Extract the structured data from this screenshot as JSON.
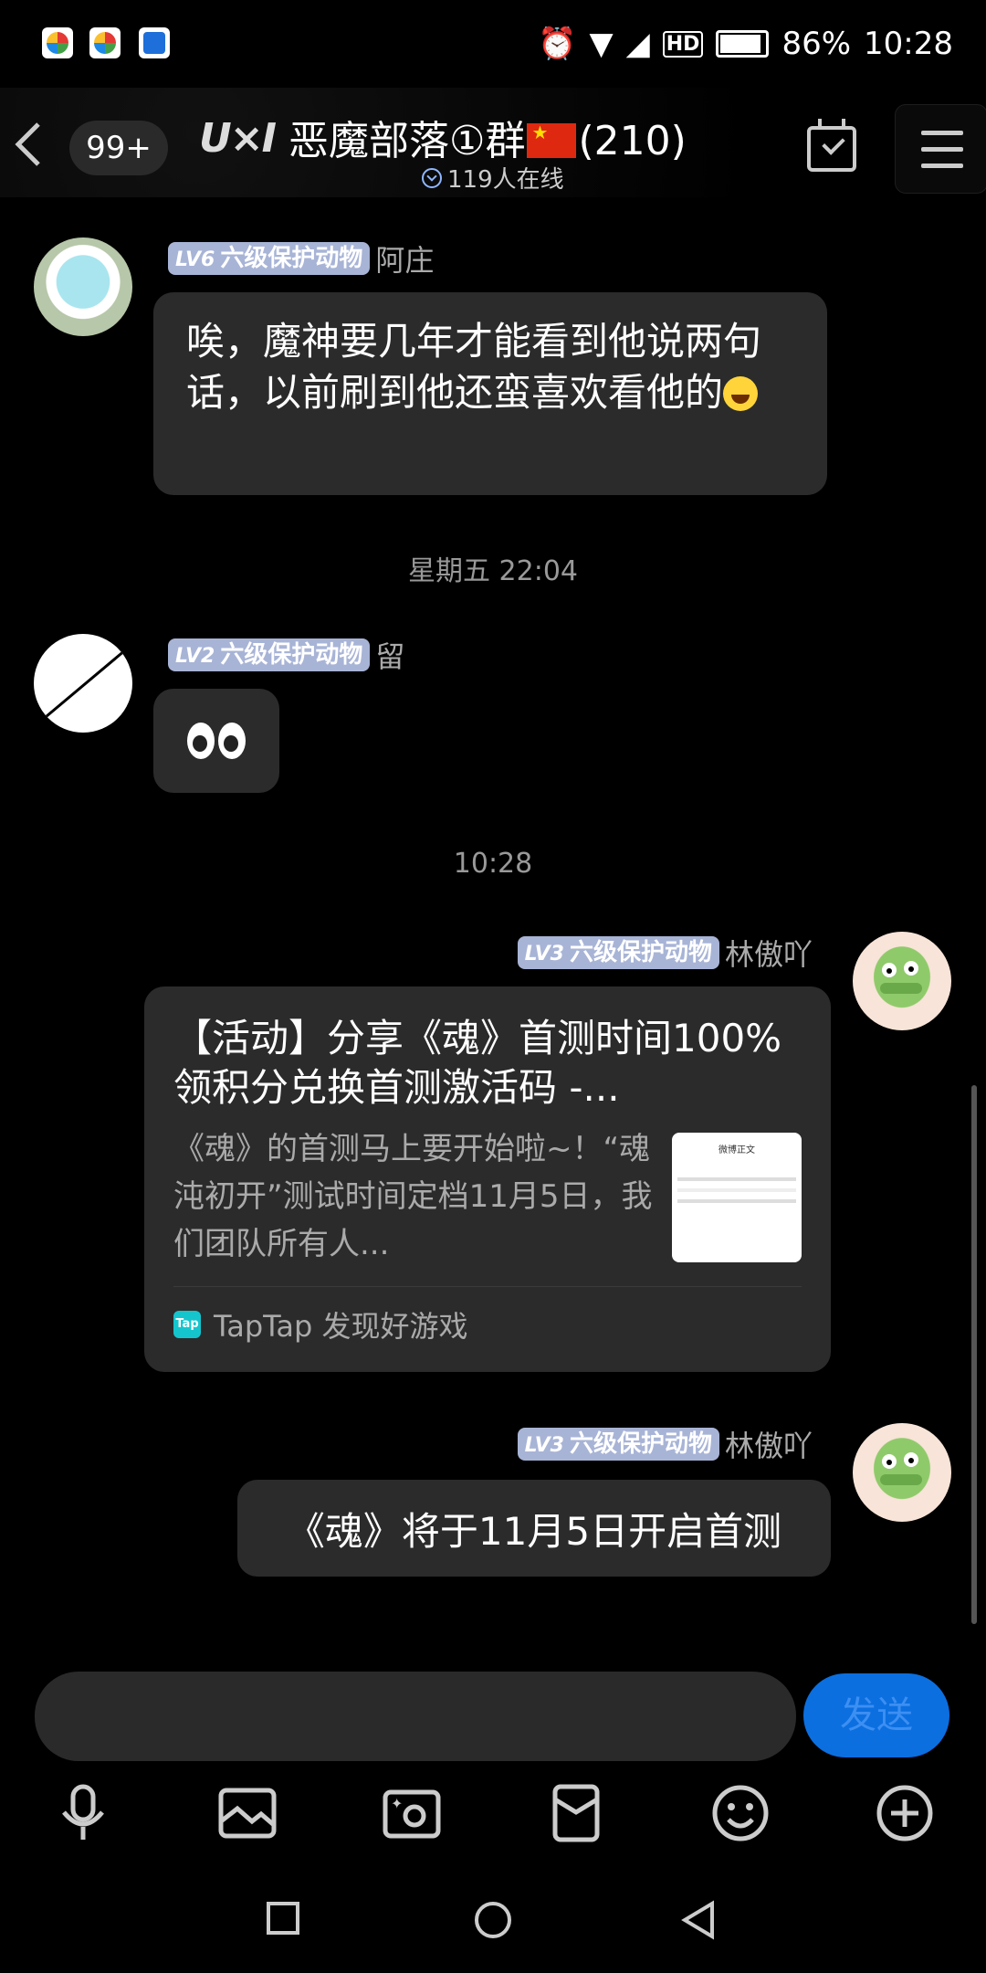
{
  "status_bar": {
    "battery": "86%",
    "time": "10:28",
    "icons": [
      "notification-app-icon",
      "notification-app-icon",
      "du-icon",
      "alarm-icon",
      "wifi-icon",
      "signal-icon",
      "hd-icon",
      "battery-icon"
    ]
  },
  "header": {
    "unread_badge": "99+",
    "logo": "U×I",
    "title_prefix": "恶魔部落①群",
    "title_suffix": "(210)",
    "online": "119人在线"
  },
  "messages": [
    {
      "level": "LV6",
      "level_title": "六级保护动物",
      "name": "阿庄",
      "text_before_emoji": "唉，魔神要几年才能看到他说两句话，以前刷到他还蛮喜欢看他的"
    },
    {
      "timestamp": "星期五 22:04"
    },
    {
      "level": "LV2",
      "level_title": "六级保护动物",
      "name": "留"
    },
    {
      "timestamp": "10:28"
    },
    {
      "level": "LV3",
      "level_title": "六级保护动物",
      "name": "林傲吖",
      "card": {
        "title": "【活动】分享《魂》首测时间100%领积分兑换首测激活码 -...",
        "desc": "《魂》的首测马上要开始啦~！“魂沌初开”测试时间定档11月5日，我们团队所有人...",
        "thumb_title": "微博正文",
        "source_logo": "Tap",
        "source": "TapTap 发现好游戏"
      }
    },
    {
      "level": "LV3",
      "level_title": "六级保护动物",
      "name": "林傲吖",
      "text": "《魂》将于11月5日开启首测"
    }
  ],
  "input": {
    "placeholder": "",
    "send_label": "发送"
  },
  "colors": {
    "send_bg": "#0b6fe0",
    "level_badge": "#a8b4d6",
    "bubble": "#2b2b2b"
  },
  "toolbar": [
    "microphone-icon",
    "image-icon",
    "camera-icon",
    "red-packet-icon",
    "emoji-icon",
    "plus-icon"
  ]
}
